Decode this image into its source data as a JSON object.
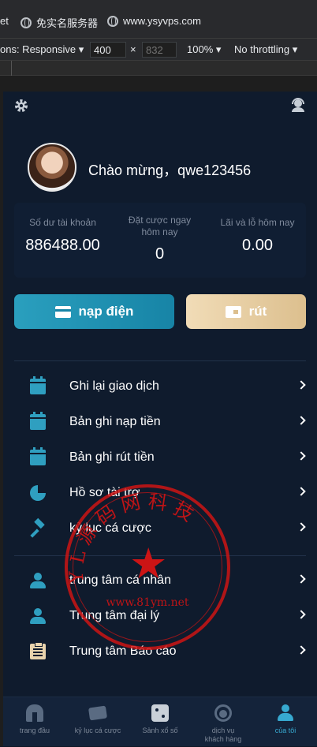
{
  "browser": {
    "bookmarks": [
      {
        "label": "et"
      },
      {
        "label": "免实名服务器"
      },
      {
        "label": "www.ysyvps.com"
      }
    ],
    "devtools": {
      "dimensions_label": "ons: Responsive",
      "width_value": "400",
      "height_placeholder": "832",
      "zoom": "100%",
      "throttling": "No throttling",
      "times": "×"
    }
  },
  "profile": {
    "greeting": "Chào mừng，qwe123456"
  },
  "stats": [
    {
      "label": "Số dư tài khoản",
      "value": "886488.00"
    },
    {
      "label": "Đặt cược ngay hôm nay",
      "value": "0"
    },
    {
      "label": "Lãi và lỗ hôm nay",
      "value": "0.00"
    }
  ],
  "actions": {
    "deposit_label": "nạp điện",
    "withdraw_label": "rút"
  },
  "menu_group_1": [
    {
      "label": "Ghi lại giao dịch",
      "icon": "calendar-icon"
    },
    {
      "label": "Bản ghi nạp tiền",
      "icon": "calendar-icon"
    },
    {
      "label": "Bản ghi rút tiền",
      "icon": "calendar-icon"
    },
    {
      "label": "Hồ sơ tài trợ",
      "icon": "pie-chart-icon"
    },
    {
      "label": "kỷ lục cá cược",
      "icon": "gavel-icon"
    }
  ],
  "menu_group_2": [
    {
      "label": "trung tâm cá nhân",
      "icon": "person-icon"
    },
    {
      "label": "Trung tâm đại lý",
      "icon": "person-icon"
    },
    {
      "label": "Trung tâm Báo cáo",
      "icon": "clipboard-icon"
    }
  ],
  "stamp": {
    "text": "Y L 源 码 网 科 技",
    "url": "www.81ym.net"
  },
  "bottom_nav": [
    {
      "label": "trang đầu",
      "icon": "home-icon"
    },
    {
      "label": "kỷ lục cá cược",
      "icon": "ticket-icon"
    },
    {
      "label": "Sảnh xổ số",
      "icon": "dice-icon"
    },
    {
      "label": "dịch vụ khách hàng",
      "icon": "customer-service-icon"
    },
    {
      "label": "của tôi",
      "icon": "user-icon"
    }
  ],
  "colors": {
    "background": "#0f1b2d",
    "accent": "#2f9fc0",
    "gold": "#dcbf8e",
    "active_nav": "#37a9d0",
    "stamp_red": "#cc1414"
  }
}
